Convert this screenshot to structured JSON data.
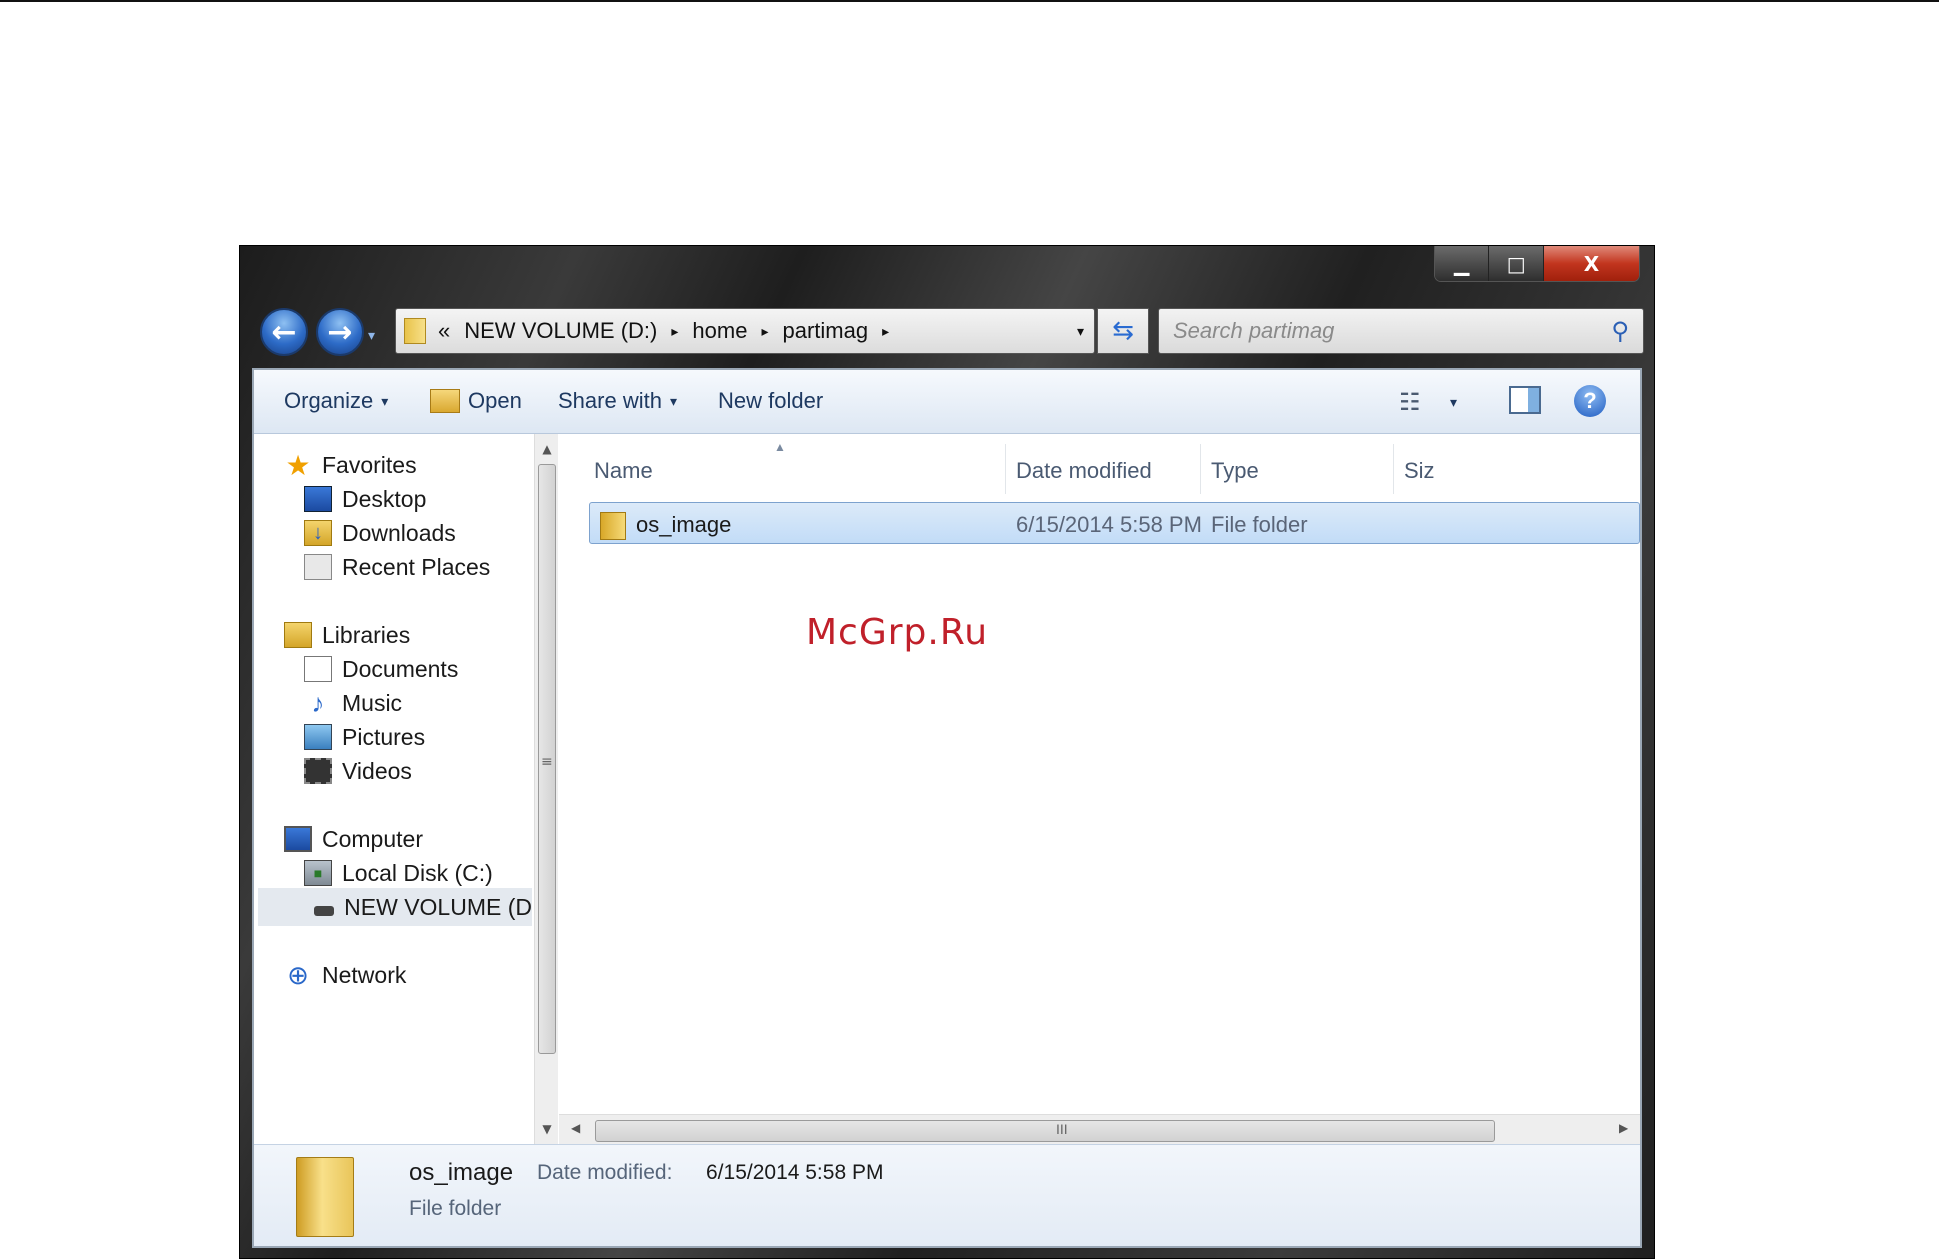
{
  "window": {
    "caption": {
      "minimize": "▁",
      "maximize": "□",
      "close": "X"
    }
  },
  "nav": {
    "back": "←",
    "forward": "→",
    "recent": "▾"
  },
  "address": {
    "overflow": "«",
    "segments": [
      "NEW VOLUME (D:)",
      "home",
      "partimag"
    ],
    "separator": "▸",
    "dropdown": "▾",
    "refresh": "⇆"
  },
  "search": {
    "placeholder": "Search partimag",
    "icon": "⚲"
  },
  "toolbar": {
    "organize": "Organize",
    "open": "Open",
    "share_with": "Share with",
    "new_folder": "New folder",
    "caret": "▾",
    "views_icon": "☷",
    "help": "?"
  },
  "sidebar": {
    "favorites": {
      "label": "Favorites",
      "items": [
        "Desktop",
        "Downloads",
        "Recent Places"
      ]
    },
    "libraries": {
      "label": "Libraries",
      "items": [
        "Documents",
        "Music",
        "Pictures",
        "Videos"
      ]
    },
    "computer": {
      "label": "Computer",
      "items": [
        "Local Disk (C:)",
        "NEW VOLUME (D"
      ]
    },
    "network": {
      "label": "Network"
    },
    "selected": "NEW VOLUME (D"
  },
  "file_list": {
    "columns": [
      "Name",
      "Date modified",
      "Type",
      "Siz"
    ],
    "rows": [
      {
        "name": "os_image",
        "date": "6/15/2014 5:58 PM",
        "type": "File folder"
      }
    ]
  },
  "scroll": {
    "grip_v": "≡",
    "grip_h": "III",
    "up": "▲",
    "down": "▼",
    "left": "◀",
    "right": "▶"
  },
  "watermark": "McGrp.Ru",
  "details": {
    "name": "os_image",
    "date_label": "Date modified:",
    "date_value": "6/15/2014 5:58 PM",
    "type": "File folder"
  },
  "colors": {
    "selection": "#c2dcf7",
    "toolbar_text": "#1e3961",
    "watermark": "#c0202a",
    "close_button": "#c2351e"
  }
}
